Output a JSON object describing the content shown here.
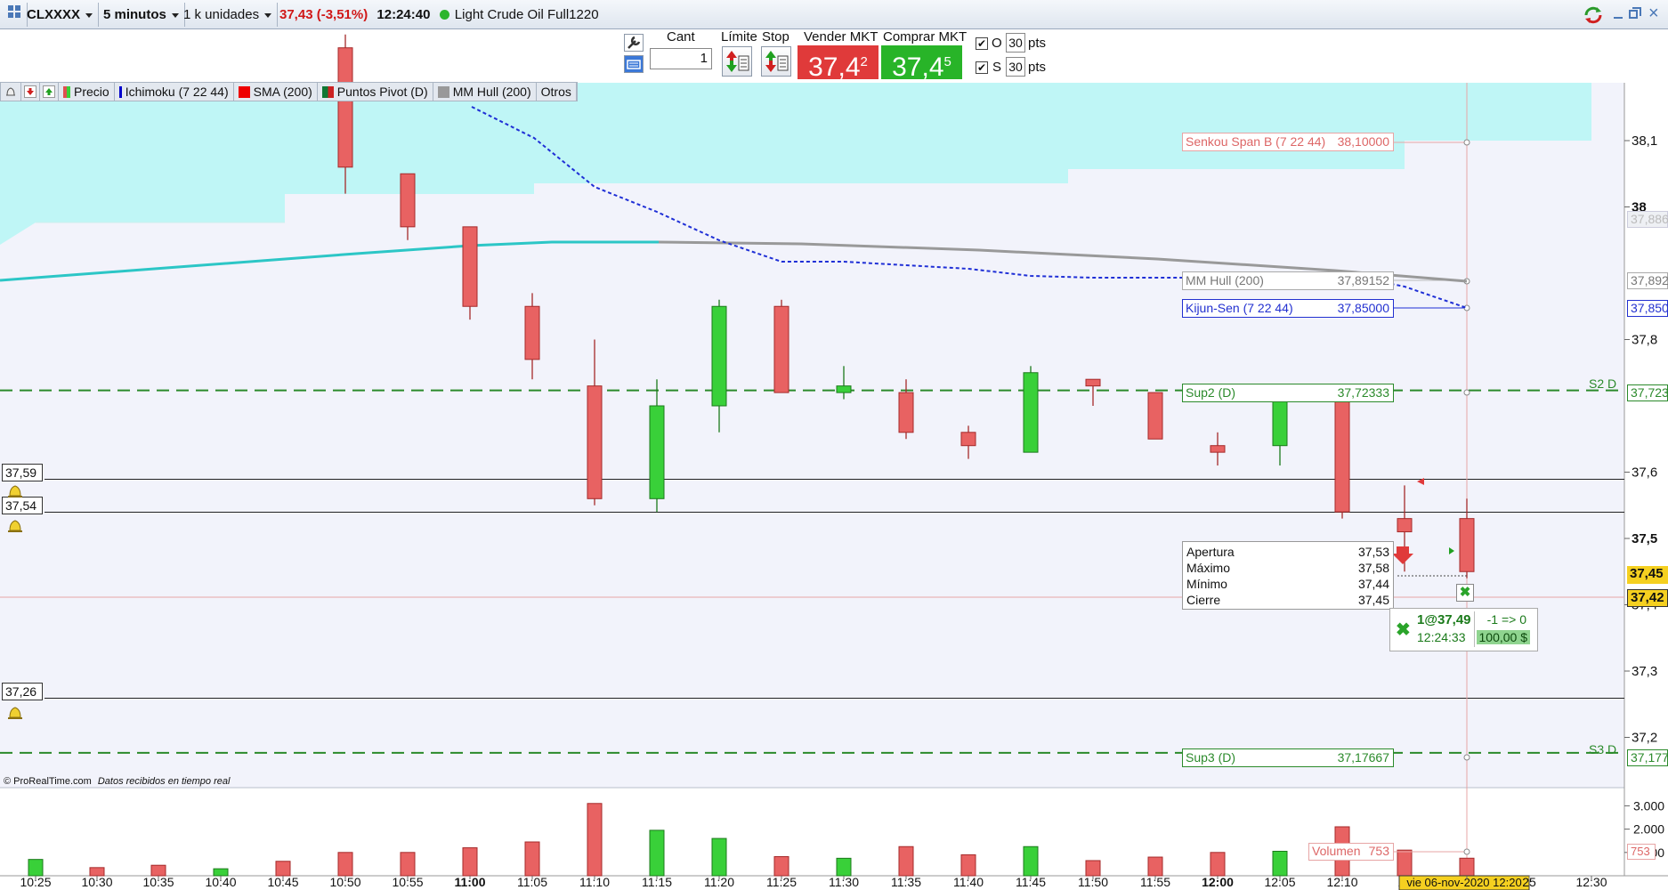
{
  "topbar": {
    "instrument": "CLXXXX",
    "timeframe": "5 minutos",
    "units": "1 k unidades",
    "quote": "37,43 (-3,51%)",
    "time": "12:24:40",
    "name": "Light Crude Oil Full1220"
  },
  "order_panel": {
    "cant_label": "Cant",
    "cant_value": "1",
    "limit_label": "Límite",
    "stop_label": "Stop",
    "sell_label": "Vender MKT",
    "sell_price": "37,4",
    "sell_sup": "2",
    "buy_label": "Comprar MKT",
    "buy_price": "37,4",
    "buy_sup": "5",
    "o_label": "O",
    "o_value": "30",
    "o_unit": "pts",
    "s_label": "S",
    "s_value": "30",
    "s_unit": "pts"
  },
  "indicators": [
    {
      "label": "Precio",
      "color": "#e05050"
    },
    {
      "label": "Ichimoku (7 22 44)",
      "color": "#0000cc"
    },
    {
      "label": "SMA (200)",
      "color": "#ee0000"
    },
    {
      "label": "Puntos Pivot (D)",
      "color": "#117733"
    },
    {
      "label": "MM Hull (200)",
      "color": "#999999"
    },
    {
      "label": "Otros",
      "color": ""
    }
  ],
  "colors": {
    "bull": "#39d039",
    "bear": "#e86262",
    "cloud": "#bff6f6",
    "kijun": "#1f2fd6",
    "hull": "#999999",
    "sma": "#2cc6c6",
    "pivot": "#2b8a2b"
  },
  "chart_data": {
    "type": "candlestick",
    "x_ticks": [
      "10:25",
      "10:30",
      "10:35",
      "10:40",
      "10:45",
      "10:50",
      "10:55",
      "11:00",
      "11:05",
      "11:10",
      "11:15",
      "11:20",
      "11:25",
      "11:30",
      "11:35",
      "11:40",
      "11:45",
      "11:50",
      "11:55",
      "12:00",
      "12:05",
      "12:10",
      "12",
      "vie 06-nov-2020 12:20",
      "25",
      "12:30"
    ],
    "y_ticks": [
      "38,1",
      "38",
      "37,8",
      "37,6",
      "37,5",
      "37,4",
      "37,3",
      "37,2"
    ],
    "candles": [
      {
        "t": "10:50",
        "o": 38.24,
        "h": 38.26,
        "l": 38.02,
        "c": 38.06
      },
      {
        "t": "10:55",
        "o": 38.05,
        "h": 38.05,
        "l": 37.95,
        "c": 37.97
      },
      {
        "t": "11:00",
        "o": 37.97,
        "h": 37.97,
        "l": 37.83,
        "c": 37.85
      },
      {
        "t": "11:05",
        "o": 37.85,
        "h": 37.87,
        "l": 37.74,
        "c": 37.77
      },
      {
        "t": "11:10",
        "o": 37.73,
        "h": 37.8,
        "l": 37.55,
        "c": 37.56
      },
      {
        "t": "11:15",
        "o": 37.56,
        "h": 37.74,
        "l": 37.54,
        "c": 37.7
      },
      {
        "t": "11:20",
        "o": 37.7,
        "h": 37.86,
        "l": 37.66,
        "c": 37.85
      },
      {
        "t": "11:25",
        "o": 37.85,
        "h": 37.86,
        "l": 37.72,
        "c": 37.72
      },
      {
        "t": "11:30",
        "o": 37.72,
        "h": 37.76,
        "l": 37.71,
        "c": 37.73
      },
      {
        "t": "11:35",
        "o": 37.72,
        "h": 37.74,
        "l": 37.65,
        "c": 37.66
      },
      {
        "t": "11:40",
        "o": 37.66,
        "h": 37.67,
        "l": 37.62,
        "c": 37.64
      },
      {
        "t": "11:45",
        "o": 37.63,
        "h": 37.76,
        "l": 37.63,
        "c": 37.75
      },
      {
        "t": "11:50",
        "o": 37.74,
        "h": 37.74,
        "l": 37.7,
        "c": 37.73
      },
      {
        "t": "11:55",
        "o": 37.72,
        "h": 37.72,
        "l": 37.65,
        "c": 37.65
      },
      {
        "t": "12:00",
        "o": 37.64,
        "h": 37.66,
        "l": 37.61,
        "c": 37.63
      },
      {
        "t": "12:05",
        "o": 37.64,
        "h": 37.72,
        "l": 37.61,
        "c": 37.71
      },
      {
        "t": "12:10",
        "o": 37.71,
        "h": 37.71,
        "l": 37.53,
        "c": 37.54
      },
      {
        "t": "12:15",
        "o": 37.53,
        "h": 37.58,
        "l": 37.45,
        "c": 37.51
      },
      {
        "t": "12:20",
        "o": 37.53,
        "h": 37.56,
        "l": 37.44,
        "c": 37.45
      }
    ],
    "volume_ticks": [
      "3.000",
      "2.000",
      "1.000"
    ],
    "volume": [
      {
        "t": "10:25",
        "v": 700,
        "bull": true
      },
      {
        "t": "10:30",
        "v": 350,
        "bull": false
      },
      {
        "t": "10:35",
        "v": 450,
        "bull": false
      },
      {
        "t": "10:40",
        "v": 300,
        "bull": true
      },
      {
        "t": "10:45",
        "v": 620,
        "bull": false
      },
      {
        "t": "10:50",
        "v": 1000,
        "bull": false
      },
      {
        "t": "10:55",
        "v": 1000,
        "bull": false
      },
      {
        "t": "11:00",
        "v": 1200,
        "bull": false
      },
      {
        "t": "11:05",
        "v": 1450,
        "bull": false
      },
      {
        "t": "11:10",
        "v": 3100,
        "bull": false
      },
      {
        "t": "11:15",
        "v": 1950,
        "bull": true
      },
      {
        "t": "11:20",
        "v": 1600,
        "bull": true
      },
      {
        "t": "11:25",
        "v": 820,
        "bull": false
      },
      {
        "t": "11:30",
        "v": 750,
        "bull": true
      },
      {
        "t": "11:35",
        "v": 1250,
        "bull": false
      },
      {
        "t": "11:40",
        "v": 900,
        "bull": false
      },
      {
        "t": "11:45",
        "v": 1250,
        "bull": true
      },
      {
        "t": "11:50",
        "v": 650,
        "bull": false
      },
      {
        "t": "11:55",
        "v": 800,
        "bull": false
      },
      {
        "t": "12:00",
        "v": 1000,
        "bull": false
      },
      {
        "t": "12:05",
        "v": 1050,
        "bull": true
      },
      {
        "t": "12:10",
        "v": 2100,
        "bull": false
      },
      {
        "t": "12:15",
        "v": 1100,
        "bull": false
      },
      {
        "t": "12:20",
        "v": 753,
        "bull": false
      }
    ]
  },
  "levels": {
    "senkou_b": {
      "label": "Senkou Span B (7 22 44)",
      "value": "38,10000"
    },
    "hull": {
      "label": "MM Hull (200)",
      "value": "37,89152",
      "axis": "37,892"
    },
    "kijun": {
      "label": "Kijun-Sen (7 22 44)",
      "value": "37,85000",
      "axis": "37,850"
    },
    "sup2": {
      "label": "Sup2 (D)",
      "value": "37,72333",
      "axis": "37,723",
      "tag": "S2 D"
    },
    "sup3": {
      "label": "Sup3 (D)",
      "value": "37,17667",
      "axis": "37,177",
      "tag": "S3 D"
    },
    "alert1": "37,59",
    "alert2": "37,54",
    "alert3": "37,26",
    "last_price": "37,45",
    "bid_price": "37,42",
    "faded_axis": "37,886"
  },
  "ohlc_box": {
    "apertura_label": "Apertura",
    "apertura": "37,53",
    "maximo_label": "Máximo",
    "maximo": "37,58",
    "minimo_label": "Mínimo",
    "minimo": "37,44",
    "cierre_label": "Cierre",
    "cierre": "37,45"
  },
  "position": {
    "qty_price": "1@37,49",
    "time": "12:24:33",
    "change": "-1 => 0",
    "pnl": "100,00 $"
  },
  "volume_label": {
    "label": "Volumen",
    "value": "753",
    "axis": "753"
  },
  "footer": {
    "brand": "© ProRealTime.com",
    "note": "Datos recibidos en tiempo real"
  }
}
